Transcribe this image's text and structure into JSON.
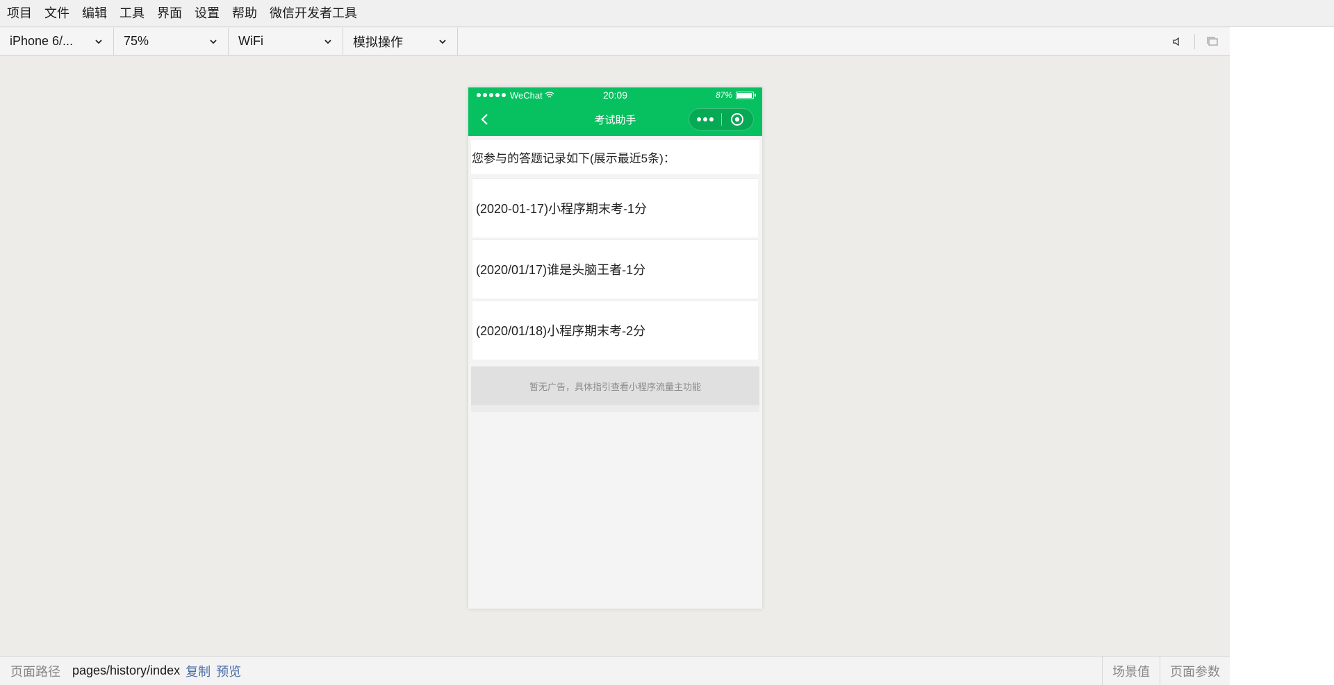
{
  "menu": {
    "items": [
      "项目",
      "文件",
      "编辑",
      "工具",
      "界面",
      "设置",
      "帮助",
      "微信开发者工具"
    ]
  },
  "toolbar": {
    "device": "iPhone 6/...",
    "zoom": "75%",
    "network": "WiFi",
    "simulate": "模拟操作",
    "icons": [
      "speaker-icon",
      "window-icon"
    ]
  },
  "phone": {
    "statusbar": {
      "carrier": "WeChat",
      "time": "20:09",
      "battery": "87%",
      "battery_level": 0.87
    },
    "navbar": {
      "title": "考试助手"
    },
    "header": "您参与的答题记录如下(展示最近5条)：",
    "records": [
      "(2020-01-17)小程序期末考-1分",
      "(2020/01/17)谁是头脑王者-1分",
      "(2020/01/18)小程序期末考-2分"
    ],
    "ad_text": "暂无广告，具体指引查看小程序流量主功能"
  },
  "bottombar": {
    "path_label": "页面路径",
    "path_value": "pages/history/index",
    "copy_label": "复制",
    "preview_label": "预览",
    "scene_label": "场景值",
    "params_label": "页面参数"
  },
  "colors": {
    "wechat_green": "#07c160",
    "link_blue": "#4a6ea8"
  }
}
